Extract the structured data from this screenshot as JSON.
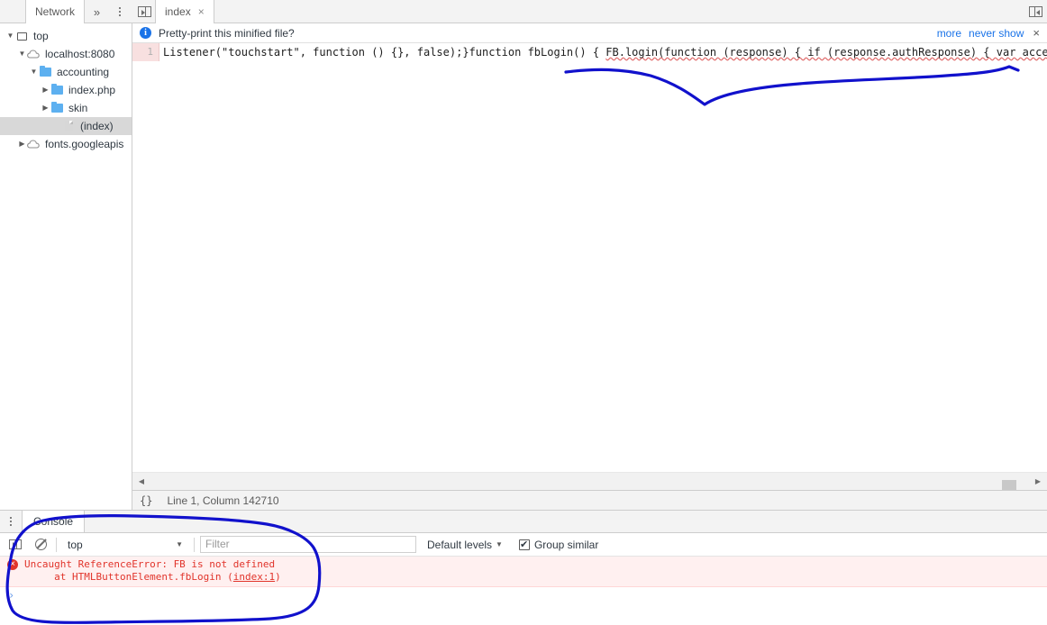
{
  "left_panel": {
    "tab_label": "Network",
    "more_icon": "chevron-double-right-icon",
    "menu_icon": "kebab-menu-icon",
    "tree": [
      {
        "label": "top",
        "icon": "frame-icon",
        "twisty": "▼",
        "indent": 0,
        "selected": false
      },
      {
        "label": "localhost:8080",
        "icon": "cloud-icon",
        "twisty": "▼",
        "indent": 1,
        "selected": false
      },
      {
        "label": "accounting",
        "icon": "folder-icon",
        "twisty": "▼",
        "indent": 2,
        "selected": false
      },
      {
        "label": "index.php",
        "icon": "folder-icon",
        "twisty": "▶",
        "indent": 3,
        "selected": false
      },
      {
        "label": "skin",
        "icon": "folder-icon",
        "twisty": "▶",
        "indent": 3,
        "selected": false
      },
      {
        "label": "(index)",
        "icon": "file-icon",
        "twisty": "",
        "indent": 4,
        "selected": true
      },
      {
        "label": "fonts.googleapis",
        "icon": "cloud-icon",
        "twisty": "▶",
        "indent": 1,
        "selected": false
      }
    ]
  },
  "editor_panel": {
    "dock_icon": "dock-to-left-icon",
    "tab_label": "index",
    "tab_close": "×",
    "right_dock_icon": "dock-to-right-icon",
    "infobar": {
      "icon": "info-icon",
      "message": "Pretty-print this minified file?",
      "more_label": "more",
      "never_show_label": "never show",
      "close_label": "×"
    },
    "code": {
      "line_number": "1",
      "text_before": "Listener(\"touchstart\", function () {}, false);}function fbLogin() { ",
      "text_squiggly": "FB.login(function (response) { if (response.authResponse) { var accessToken = re"
    },
    "status": {
      "format_icon": "{}",
      "cursor_position": "Line 1, Column 142710"
    }
  },
  "drawer": {
    "menu_icon": "kebab-menu-icon",
    "tab_label": "Console",
    "toolbar": {
      "sidebar_icon": "console-sidebar-icon",
      "clear_icon": "clear-console-icon",
      "context_value": "top",
      "context_caret": "▼",
      "filter_placeholder": "Filter",
      "levels_label": "Default levels",
      "levels_caret": "▼",
      "group_similar_label": "Group similar",
      "group_similar_checked": true
    },
    "messages": [
      {
        "icon": "error-icon",
        "icon_glyph": "×",
        "line1": "Uncaught ReferenceError: FB is not defined",
        "line2_prefix": "     at HTMLButtonElement.fbLogin (",
        "line2_link": "index:1",
        "line2_suffix": ")"
      }
    ],
    "prompt_caret": "›"
  },
  "annotations": {
    "ink_color": "#1111cc",
    "stroke_width": 3,
    "shapes": [
      {
        "name": "code-underline-squiggle",
        "type": "polyline"
      },
      {
        "name": "console-lasso-circle",
        "type": "closed-loop"
      }
    ]
  },
  "colors": {
    "accent_blue": "#1a73e8",
    "error_red": "#e1342b",
    "error_bg": "#fff0f0",
    "chrome_gray": "#f3f3f3",
    "border_gray": "#cdcdcd",
    "folder_blue": "#5db0f0",
    "annotation_blue": "#1111cc"
  }
}
